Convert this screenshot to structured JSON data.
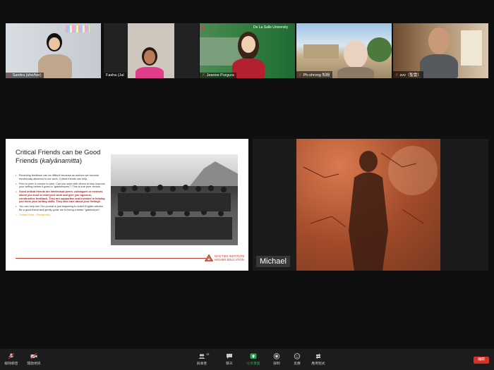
{
  "participants": [
    {
      "name": "Sanitra (she/her)"
    },
    {
      "name": "Fasha (Jal"
    },
    {
      "name": "Jeanne Purgura"
    },
    {
      "name": "Ph-shrong 知紛"
    },
    {
      "name": "svv（聖雲）"
    }
  ],
  "participant_mic_icon": "mic-muted-icon",
  "tile_badges": {
    "jeanne_logo_text": "De La Salle University"
  },
  "slide": {
    "title_line1": "Critical Friends can be Good",
    "title_line2": "Friends (",
    "title_term": "kalyānamitta",
    "title_close": ")",
    "bullets": [
      "Receiving feedback can be difficult because as authors we become emotionally attached to our work. Critical friends can help.",
      "Peer to peer & mentor to peer. Can you work with others to help improve your writing before it goes to \"gatekeepers\"? This is true peer review.",
      "Good critical friends are intellectual peers, colleagues or mentors whom you trust to read your work and give you rigorous, constructive feedback. They are supportive and invested in helping you hone your writing skills. They also care about your feelings.",
      "You can help me! Our journal is just beginning to solicit English articles. Be a good friend and gently guide me to being a better \"gatekeeper\"."
    ],
    "golden_rule": "Golden Rule = Reciprocity",
    "logo_line1": "NAN TIEN INSTITUTE",
    "logo_line2": "HIGHER EDUCATION"
  },
  "featured_participant": {
    "name": "Michael"
  },
  "toolbar": {
    "items": [
      {
        "label": "解除靜音",
        "icon": "microphone-icon"
      },
      {
        "label": "開啟視訊",
        "icon": "video-camera-icon"
      },
      {
        "label": "與會者",
        "icon": "participants-icon",
        "count": "11"
      },
      {
        "label": "聊天",
        "icon": "chat-icon"
      },
      {
        "label": "分享畫面",
        "icon": "share-screen-icon"
      },
      {
        "label": "錄制",
        "icon": "record-icon"
      },
      {
        "label": "反應",
        "icon": "reaction-icon"
      },
      {
        "label": "應用程式",
        "icon": "apps-icon"
      }
    ],
    "end_label": "離開",
    "accent": "#d93025"
  },
  "colors": {
    "background": "#0f0f0f",
    "share_green": "#23a559",
    "muted_red": "#e03a3a"
  }
}
